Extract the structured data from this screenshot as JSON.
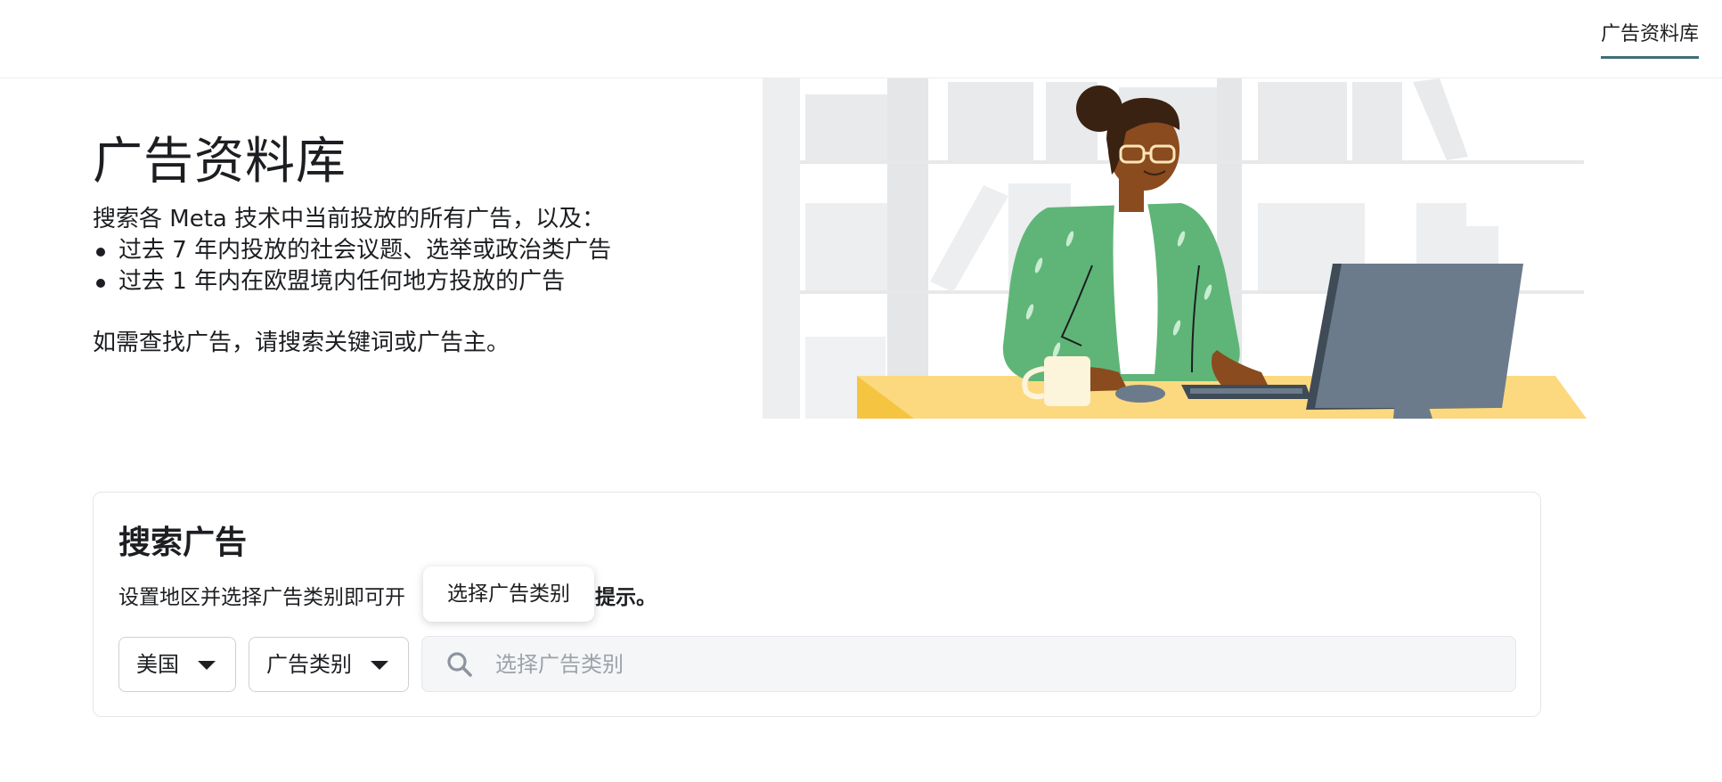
{
  "header": {
    "tab_label": "广告资料库"
  },
  "hero": {
    "title": "广告资料库",
    "intro": "搜索各 Meta 技术中当前投放的所有广告，以及：",
    "bullets": [
      "过去 7 年内投放的社会议题、选举或政治类广告",
      "过去 1 年内在欧盟境内任何地方投放的广告"
    ],
    "hint": "如需查找广告，请搜索关键词或广告主。"
  },
  "search_card": {
    "title": "搜索广告",
    "subtitle_start": "设置地区并选择广告类别即可开",
    "subtitle_bold": "索提示。",
    "tooltip": "选择广告类别",
    "country_value": "美国",
    "category_value": "广告类别",
    "search_placeholder": "选择广告类别"
  },
  "colors": {
    "tab_underline": "#3f6f7a",
    "sweater": "#5fb577",
    "desk": "#fcd97f",
    "monitor": "#6b7b8c",
    "input_bg": "#f5f6f7"
  },
  "icons": [
    "search-icon",
    "caret-down-icon"
  ]
}
